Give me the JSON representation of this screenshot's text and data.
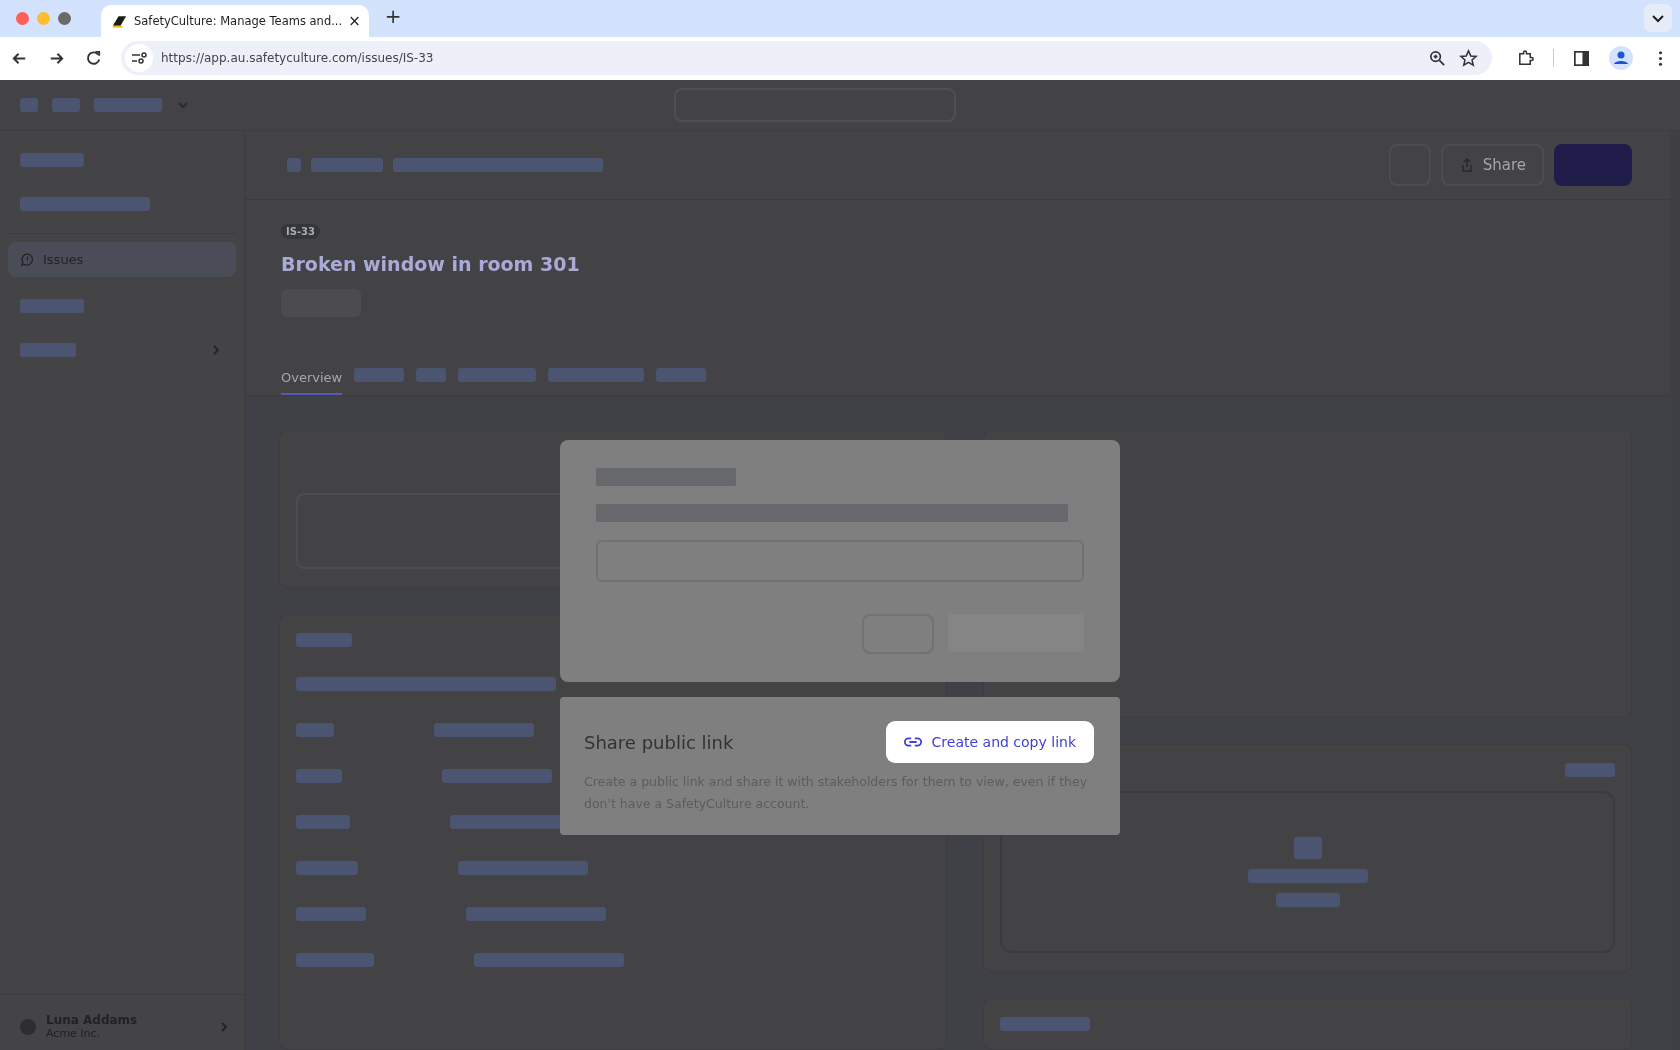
{
  "browser": {
    "tab": {
      "title": "SafetyCulture: Manage Teams and...",
      "close": "×"
    },
    "new_tab": "+",
    "url": "https://app.au.safetyculture.com/issues/IS-33"
  },
  "sidebar": {
    "items": [
      {
        "label": "Issues",
        "selected": true
      }
    ],
    "user": {
      "name": "Luna Addams",
      "org": "Acme Inc."
    }
  },
  "header": {
    "share_button": "Share"
  },
  "issue": {
    "id": "IS-33",
    "title": "Broken window in room 301"
  },
  "tabs": [
    {
      "label": "Overview",
      "selected": true
    }
  ],
  "share_panel": {
    "title": "Share public link",
    "button": "Create and copy link",
    "description": "Create a public link and share it with stakeholders for them to view, even if they don't have a SafetyCulture account."
  }
}
